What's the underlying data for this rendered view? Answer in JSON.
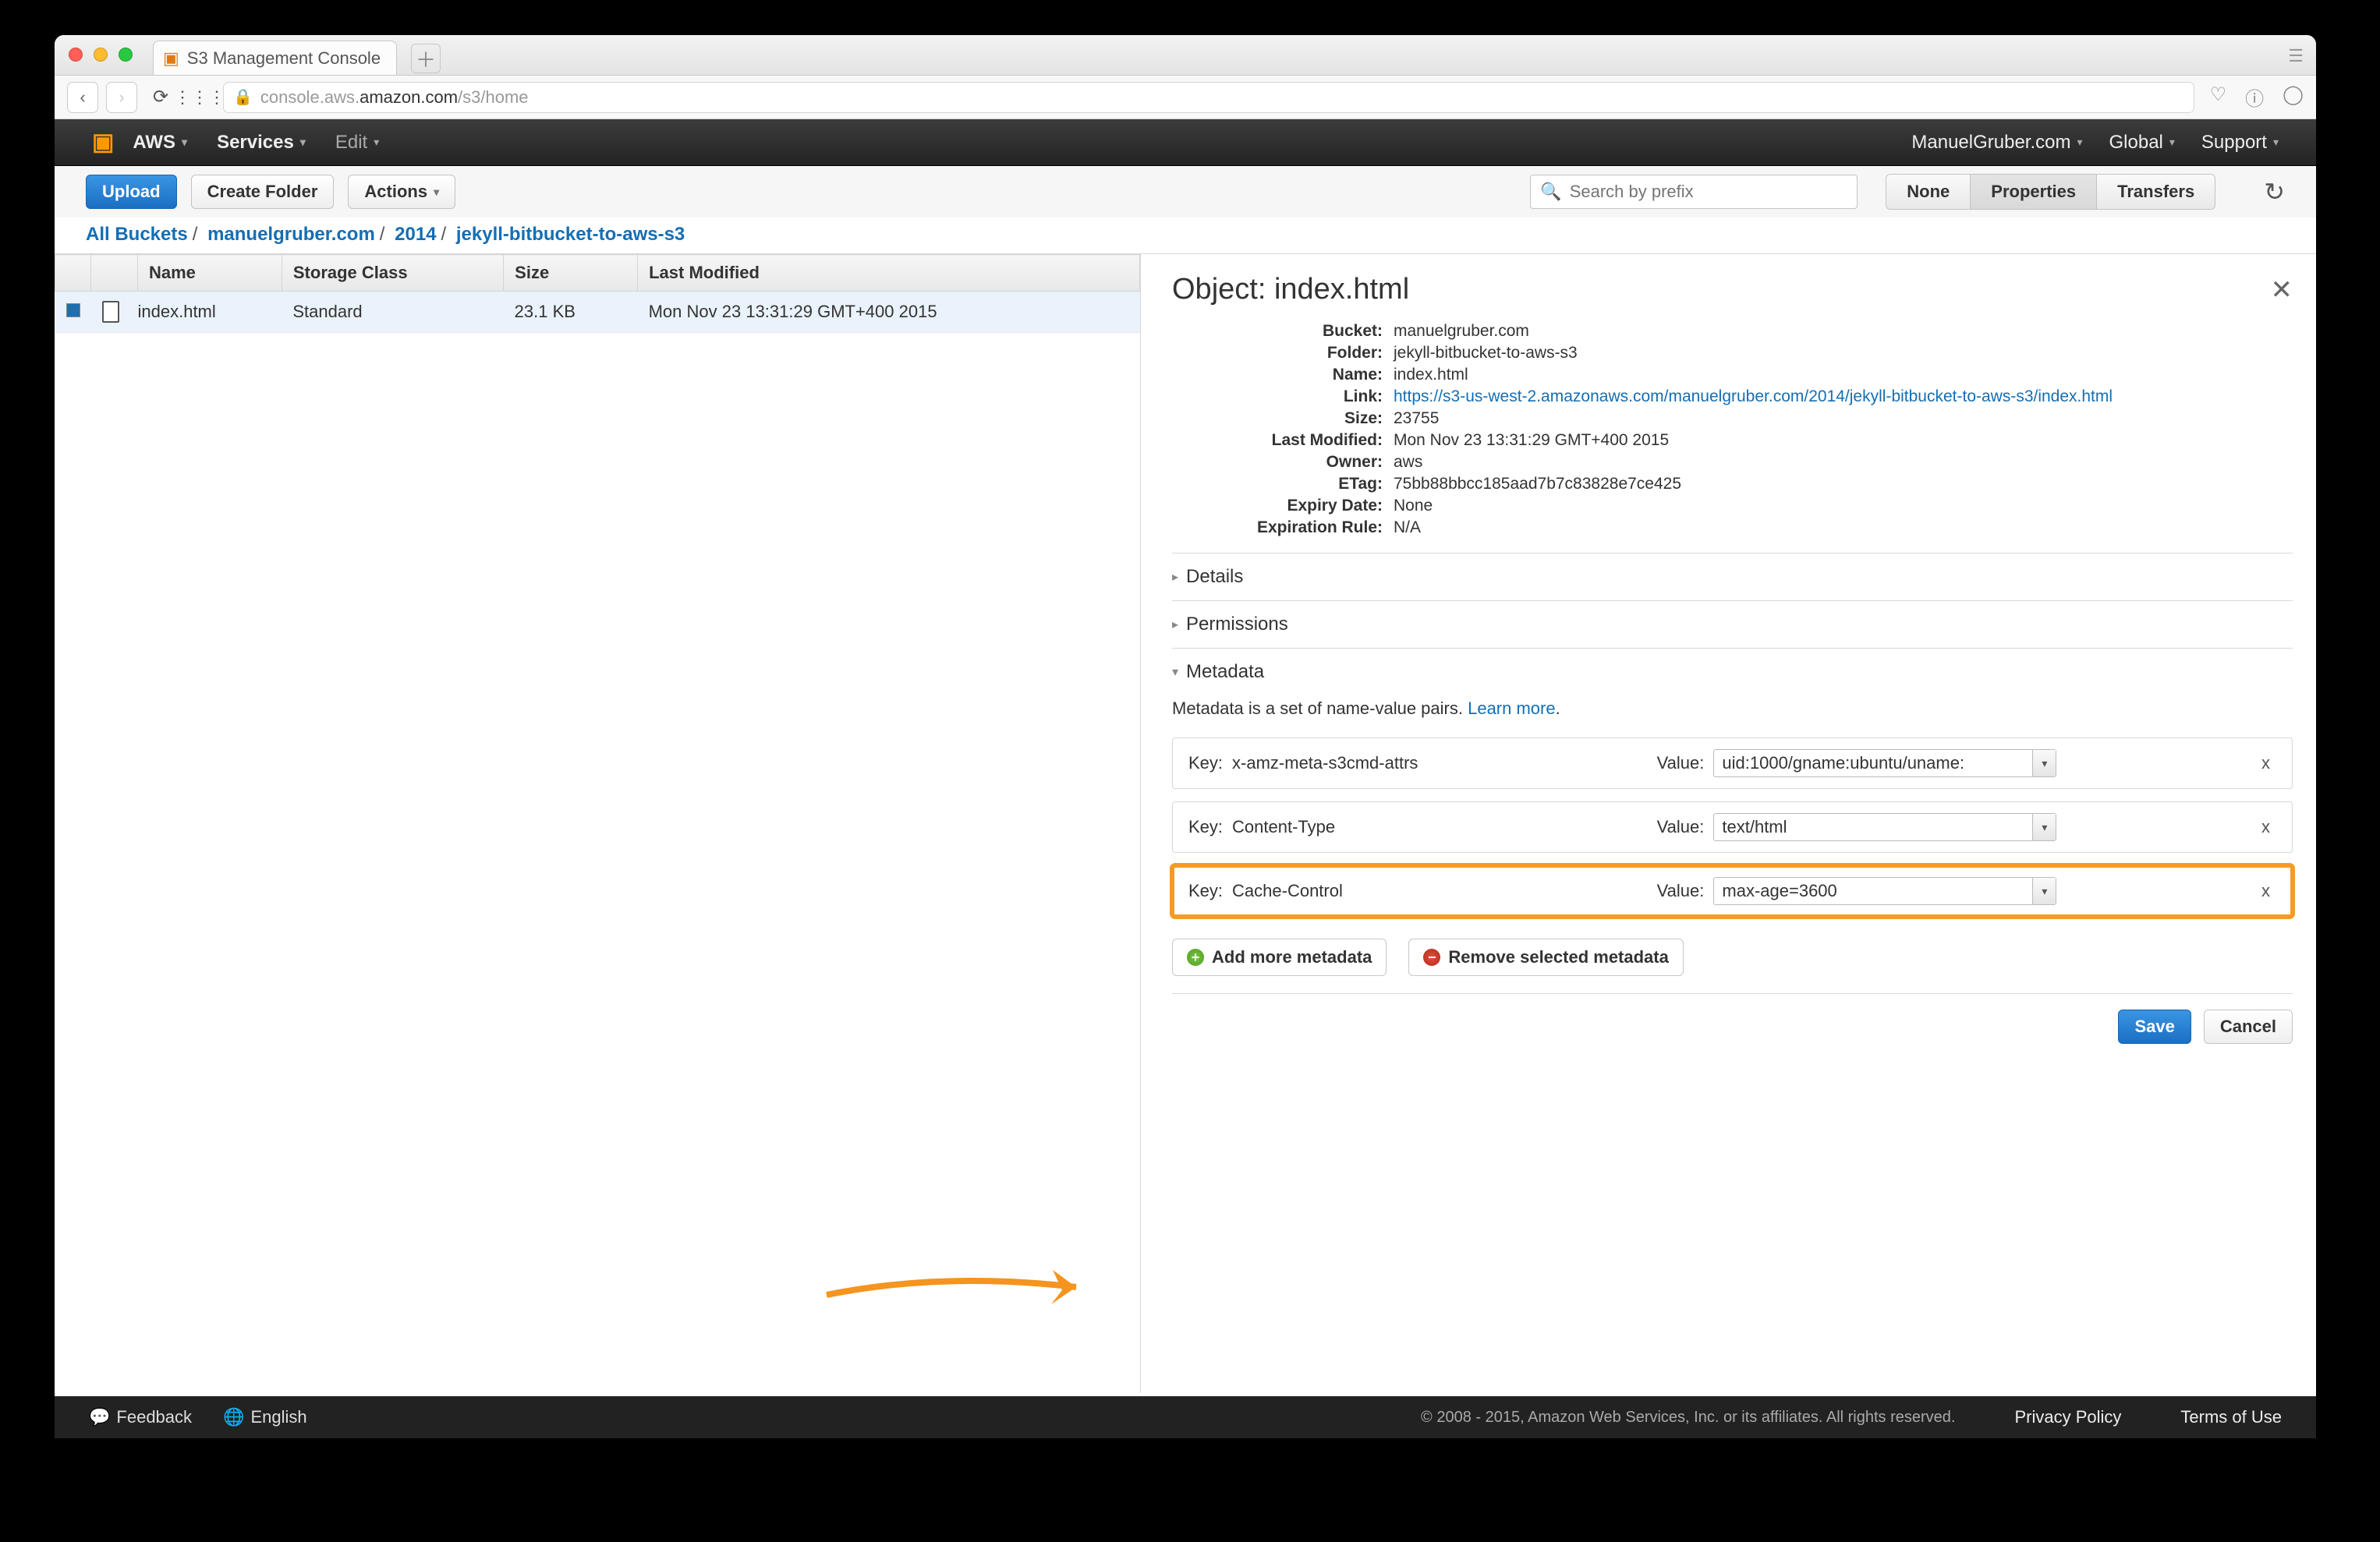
{
  "browser": {
    "tab_title": "S3 Management Console",
    "url_host_prefix": "console.aws.",
    "url_host_bold": "amazon.com",
    "url_path": "/s3/home"
  },
  "aws_nav": {
    "brand": "AWS",
    "services": "Services",
    "edit": "Edit",
    "account": "ManuelGruber.com",
    "region": "Global",
    "support": "Support"
  },
  "toolbar": {
    "upload": "Upload",
    "create_folder": "Create Folder",
    "actions": "Actions",
    "search_placeholder": "Search by prefix",
    "none": "None",
    "properties": "Properties",
    "transfers": "Transfers"
  },
  "breadcrumb": [
    "All Buckets",
    "manuelgruber.com",
    "2014",
    "jekyll-bitbucket-to-aws-s3"
  ],
  "table": {
    "headers": {
      "name": "Name",
      "storage": "Storage Class",
      "size": "Size",
      "modified": "Last Modified"
    },
    "rows": [
      {
        "name": "index.html",
        "storage": "Standard",
        "size": "23.1 KB",
        "modified": "Mon Nov 23 13:31:29 GMT+400 2015"
      }
    ]
  },
  "object_panel": {
    "title": "Object: index.html",
    "props": {
      "Bucket": "manuelgruber.com",
      "Folder": "jekyll-bitbucket-to-aws-s3",
      "Name": "index.html",
      "Link": "https://s3-us-west-2.amazonaws.com/manuelgruber.com/2014/jekyll-bitbucket-to-aws-s3/index.html",
      "Size": "23755",
      "Last Modified": "Mon Nov 23 13:31:29 GMT+400 2015",
      "Owner": "aws",
      "ETag": "75bb88bbcc185aad7b7c83828e7ce425",
      "Expiry Date": "None",
      "Expiration Rule": "N/A"
    },
    "sections": {
      "details": "Details",
      "permissions": "Permissions",
      "metadata": "Metadata"
    },
    "metadata_desc": "Metadata is a set of name-value pairs. ",
    "learn_more": "Learn more",
    "key_label": "Key:",
    "value_label": "Value:",
    "metadata": [
      {
        "key": "x-amz-meta-s3cmd-attrs",
        "value": "uid:1000/gname:ubuntu/uname:"
      },
      {
        "key": "Content-Type",
        "value": "text/html"
      },
      {
        "key": "Cache-Control",
        "value": "max-age=3600"
      }
    ],
    "add_more": "Add more metadata",
    "remove_sel": "Remove selected metadata",
    "save": "Save",
    "cancel": "Cancel"
  },
  "footer": {
    "feedback": "Feedback",
    "language": "English",
    "copyright": "© 2008 - 2015, Amazon Web Services, Inc. or its affiliates. All rights reserved.",
    "privacy": "Privacy Policy",
    "terms": "Terms of Use"
  }
}
